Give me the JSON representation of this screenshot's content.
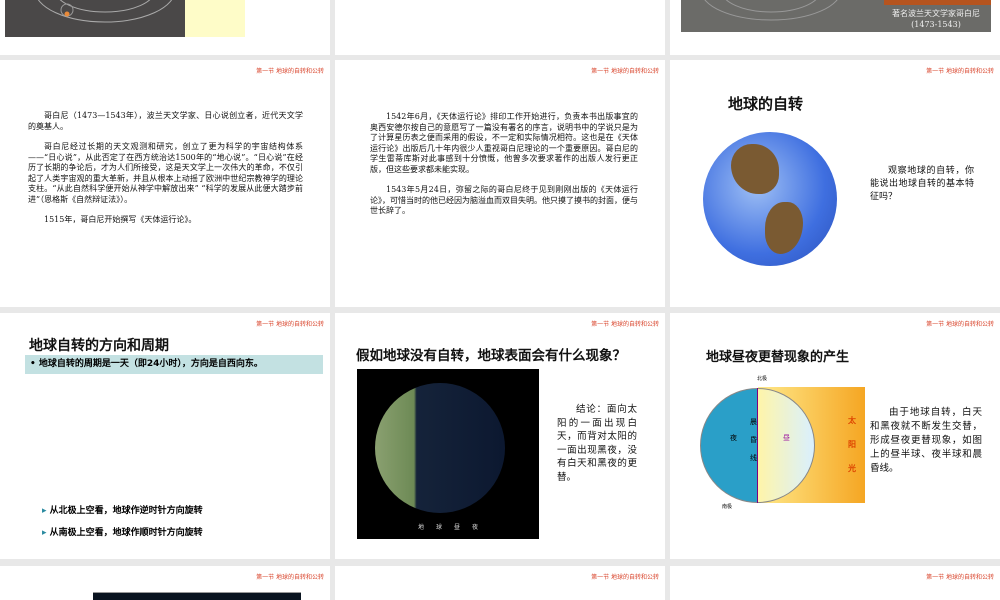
{
  "section_header": "第一节 地球的自转和公转",
  "slides": {
    "s3_caption": "著名波兰天文学家哥白尼(1473-1543)",
    "s4": {
      "paragraphs": [
        "哥白尼（1473—1543年），波兰天文学家、日心说创立者，近代天文学的奠基人。",
        "哥白尼经过长期的天文观测和研究，创立了更为科学的宇宙结构体系——“日心说”，从此否定了在西方统治达1500年的“地心说”。“日心说”在经历了长期的争论后，才为人们所接受，这是天文学上一次伟大的革命，不仅引起了人类宇宙观的重大革新，并且从根本上动摇了欧洲中世纪宗教神学的理论支柱。“从此自然科学便开始从神学中解放出来” “科学的发展从此便大踏步前进”（恩格斯《自然辩证法》）。",
        "1515年，哥白尼开始撰写《天体运行论》。"
      ]
    },
    "s5": {
      "paragraphs": [
        "1542年6月，《天体运行论》排印工作开始进行，负责本书出版事宜的奥西安德尔按自己的意愿写了一篇没有署名的序言，说明书中的学说只是为了计算星历表之便而采用的假设，不一定和实际情况相符。这也是在《天体运行论》出版后几十年内很少人重视哥白尼理论的一个重要原因。哥白尼的学生雷蒂库斯对此事感到十分愤慨，他曾多次要求著作的出版人发行更正版，但这些要求都未能实现。",
        "1543年5月24日，弥留之际的哥白尼终于见到刚刚出版的《天体运行论》，可惜当时的他已经因为脑溢血而双目失明。他只摸了摸书的封面，便与世长辞了。"
      ]
    },
    "s6": {
      "title": "地球的自转",
      "text": "观察地球的自转，你能说出地球自转的基本特征吗？"
    },
    "s7": {
      "title": "地球自转的方向和周期",
      "bullet": "地球自转的周期是一天（即24小时），方向是自西向东。",
      "points": [
        "从北极上空看，地球作逆时针方向旋转",
        "从南极上空看，地球作顺时针方向旋转"
      ]
    },
    "s8": {
      "title": "假如地球没有自转，地球表面会有什么现象？",
      "caption": "地　　球　　昼　　夜",
      "text": "结论：面向太阳的一面出现白天，而背对太阳的一面出现黑夜，没有白天和黑夜的更替。"
    },
    "s9": {
      "title": "地球昼夜更替现象的产生",
      "text": "由于地球自转，白天和黑夜就不断发生交替，形成昼夜更替现象，如图上的昼半球、夜半球和晨昏线。",
      "diagram_labels": {
        "north": "北极",
        "south": "南极",
        "sun": "太阳光",
        "night": "夜",
        "day": "昼",
        "terminator": "晨昏线"
      }
    }
  }
}
